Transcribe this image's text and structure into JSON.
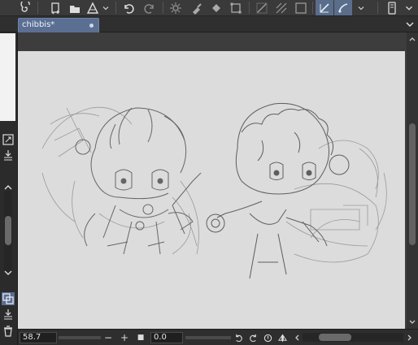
{
  "document_tab": {
    "title": "chibbis*"
  },
  "status_bar": {
    "zoom_value": "58.7",
    "zoom_out_label": "−",
    "zoom_in_label": "+",
    "fit_label": "■",
    "rotation_value": "0.0"
  },
  "colors": {
    "toolbar_bg": "#3a3a3a",
    "tab_active": "#5b6f93",
    "canvas_paper": "#dcdcdc",
    "tool_active": "#5a6e8c"
  },
  "toolbar_icons": [
    "spiral-icon",
    "new-layer-icon",
    "folder-icon",
    "cone-icon",
    "undo-icon",
    "redo-icon",
    "sparkle-icon",
    "brush-icon",
    "fill-icon",
    "transform-icon",
    "ruler-icon",
    "grid-icon",
    "pen-active-icon",
    "lasso-active-icon",
    "phone-icon"
  ]
}
